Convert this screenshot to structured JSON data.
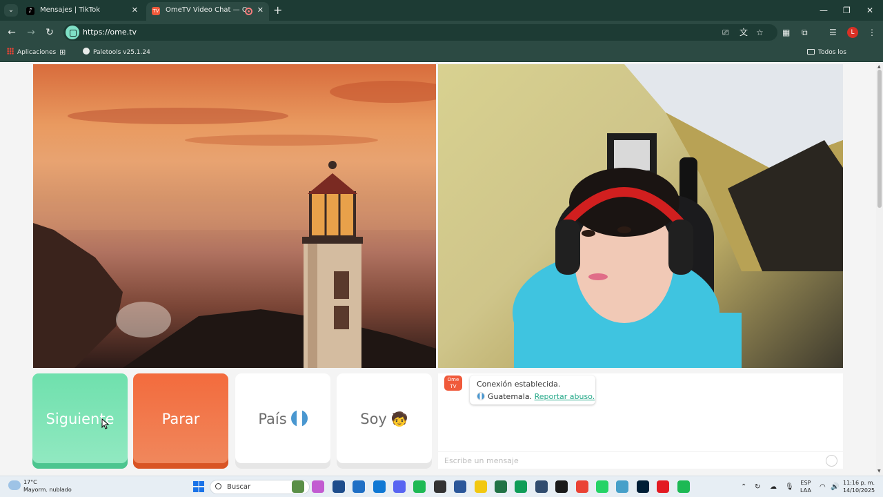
{
  "browser": {
    "tabs": [
      {
        "title": "Mensajes | TikTok",
        "icon": "tiktok-icon",
        "active": false
      },
      {
        "title": "OmeTV Video Chat — Omegle",
        "icon": "ometv-icon",
        "active": true
      }
    ],
    "url": "https://ome.tv",
    "profile_initial": "L",
    "bookmarks": {
      "apps": "Aplicaciones",
      "paletools": "Paletools v25.1.24",
      "all": "Todos los marcadores"
    }
  },
  "controls": {
    "next": "Siguiente",
    "stop": "Parar",
    "country": "País",
    "gender": "Soy",
    "gender_emoji": "🧒"
  },
  "chat": {
    "logo_top": "Ome",
    "logo_bottom": "TV",
    "status": "Conexión establecida.",
    "country": "Guatemala.",
    "report": "Reportar abuso.",
    "input_placeholder": "Escribe un mensaje"
  },
  "taskbar": {
    "weather_temp": "17°C",
    "weather_desc": "Mayorm. nublado",
    "search": "Buscar",
    "lang_top": "ESP",
    "lang_bottom": "LAA",
    "time": "11:16 p. m.",
    "date": "14/10/2025",
    "app_colors": [
      "#5a8f47",
      "#c25bd1",
      "#1e4d8c",
      "#1f6fc5",
      "#0f78d4",
      "#5865f2",
      "#1db954",
      "#333333",
      "#2b579a",
      "#f2c811",
      "#217346",
      "#0f9d58",
      "#314c6e",
      "#1a1a1a",
      "#ea4335",
      "#25d366",
      "#46a0c9",
      "#001e36",
      "#e31b23",
      "#1db954"
    ]
  }
}
